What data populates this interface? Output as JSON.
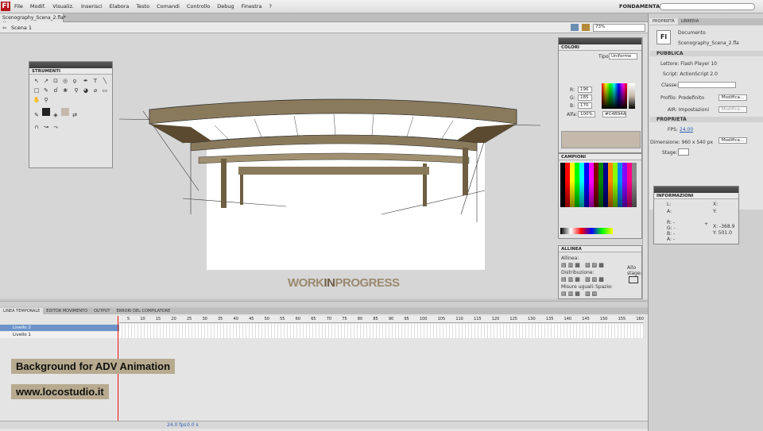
{
  "app": {
    "logo": "Fl",
    "menu": [
      "File",
      "Modif.",
      "Visualiz.",
      "Inserisci",
      "Elabora",
      "Testo",
      "Comandi",
      "Controllo",
      "Debug",
      "Finestra",
      "?"
    ],
    "workspace": "FONDAMENTALI ▾"
  },
  "document": {
    "tab": "Scenography_Scena_2.fla*",
    "scene": "Scena 1",
    "zoom": "73%"
  },
  "stage_text": {
    "work": "WORK",
    "in": "IN",
    "progress": "PROGRESS"
  },
  "tools": {
    "title": "STRUMENTI"
  },
  "colors": {
    "title": "COLORI",
    "tipo_label": "Tipo:",
    "tipo_value": "Uniforme",
    "r": "196",
    "g": "185",
    "b": "170",
    "alfa_label": "Alfa:",
    "alfa": "100%",
    "hex": "#C4B94A"
  },
  "swatches": {
    "title": "CAMPIONI"
  },
  "align": {
    "title": "ALLINEA",
    "allinea": "Allinea:",
    "distribuzione": "Distribuzione:",
    "misure": "Misure uguali:",
    "spazio": "Spazio:",
    "allo_stage": "Allo stage:"
  },
  "properties": {
    "tab1": "PROPRIETÀ",
    "tab2": "LIBRERIA",
    "icon": "Fl",
    "doc_label": "Documento",
    "doc_name": "Scenography_Scena_2.fla",
    "pubblica": "PUBBLICA",
    "lettore": "Lettore: Flash Player 10",
    "script": "Script: ActionScript 2.0",
    "classe": "Classe:",
    "profilo": "Profilo: Predefinito",
    "modifica1": "Modifica...",
    "air": "AIR: Impostazioni",
    "modifica2": "Modifica...",
    "proprieta": "PROPRIETÀ",
    "fps_label": "FPS:",
    "fps": "24.00",
    "dimensione": "Dimensione: 960 x 540 px",
    "modifica3": "Modifica...",
    "stage": "Stage:"
  },
  "info": {
    "title": "INFORMAZIONI",
    "l": "L:",
    "a": "A:",
    "x": "X:",
    "y": "Y:",
    "r": "R: -",
    "g": "G: -",
    "b": "B: -",
    "a2": "A: -",
    "xv": "X: -368.9",
    "yv": "Y: 501.0"
  },
  "timeline": {
    "tabs": [
      "LINEA TEMPORALE",
      "EDITOR MOVIMENTO",
      "OUTPUT",
      "ERRORI DEL COMPILATORE"
    ],
    "layers": [
      "Livello 2",
      "Livello 1"
    ],
    "ticks": [
      "5",
      "10",
      "15",
      "20",
      "25",
      "30",
      "35",
      "40",
      "45",
      "50",
      "55",
      "60",
      "65",
      "70",
      "75",
      "80",
      "85",
      "90",
      "95",
      "100",
      "105",
      "110",
      "115",
      "120",
      "125",
      "130",
      "135",
      "140",
      "145",
      "150",
      "155",
      "160"
    ],
    "fps": "24.0 fps",
    "time": "0.0 s"
  },
  "banners": {
    "title": "Background for ADV Animation",
    "url": "www.locostudio.it"
  }
}
